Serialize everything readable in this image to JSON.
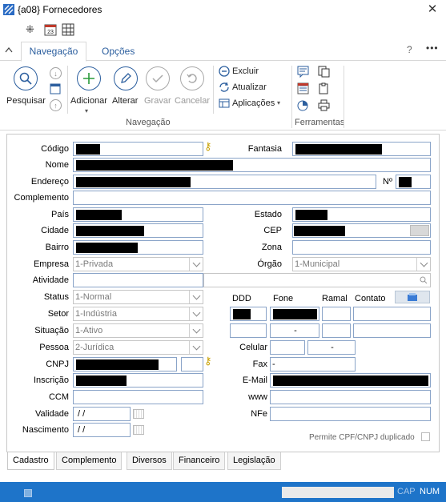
{
  "window": {
    "title": "{a08} Fornecedores",
    "close_glyph": "✕"
  },
  "quick_toolbar": [
    {
      "name": "pin-icon",
      "glyph": "⁜"
    },
    {
      "name": "calendar-icon",
      "glyph": "23"
    },
    {
      "name": "grid-icon",
      "glyph": "⊞"
    }
  ],
  "ribbon_tabs": {
    "collapse": "^",
    "nav": "Navegação",
    "opcoes": "Opções",
    "help": "?",
    "more": "•••"
  },
  "ribbon": {
    "pesquisar": "Pesquisar",
    "adicionar": "Adicionar",
    "alterar": "Alterar",
    "gravar": "Gravar",
    "cancelar": "Cancelar",
    "excluir": "Excluir",
    "atualizar": "Atualizar",
    "aplicacoes": "Aplicações",
    "group_nav": "Navegação",
    "group_ferr": "Ferramentas"
  },
  "form": {
    "codigo_label": "Código",
    "fantasia_label": "Fantasia",
    "nome_label": "Nome",
    "endereco_label": "Endereço",
    "numero_label": "Nº",
    "complemento_label": "Complemento",
    "pais_label": "País",
    "estado_label": "Estado",
    "cidade_label": "Cidade",
    "cep_label": "CEP",
    "bairro_label": "Bairro",
    "zona_label": "Zona",
    "empresa_label": "Empresa",
    "empresa_value": "1-Privada",
    "orgao_label": "Órgão",
    "orgao_value": "1-Municipal",
    "atividade_label": "Atividade",
    "status_label": "Status",
    "status_value": "1-Normal",
    "setor_label": "Setor",
    "setor_value": "1-Indústria",
    "situacao_label": "Situação",
    "situacao_value": "1-Ativo",
    "pessoa_label": "Pessoa",
    "pessoa_value": "2-Jurídica",
    "ddd_label": "DDD",
    "fone_label": "Fone",
    "ramal_label": "Ramal",
    "contato_label": "Contato",
    "fone2_value": "-",
    "cnpj_label": "CNPJ",
    "inscricao_label": "Inscrição",
    "ccm_label": "CCM",
    "validade_label": "Validade",
    "validade_value": " / /",
    "nascimento_label": "Nascimento",
    "nascimento_value": " / /",
    "celular_label": "Celular",
    "celular_value": "-",
    "fax_label": "Fax",
    "fax_value": "-",
    "email_label": "E-Mail",
    "www_label": "www",
    "nfe_label": "NFe",
    "permite_label": "Permite CPF/CNPJ duplicado"
  },
  "bottom_tabs": [
    "Cadastro",
    "Complemento",
    "Diversos",
    "Financeiro",
    "Legislação"
  ],
  "status": {
    "cap": "CAP",
    "num": "NUM"
  },
  "colors": {
    "accent": "#2b5e9e",
    "statusbar": "#1e74c9"
  }
}
